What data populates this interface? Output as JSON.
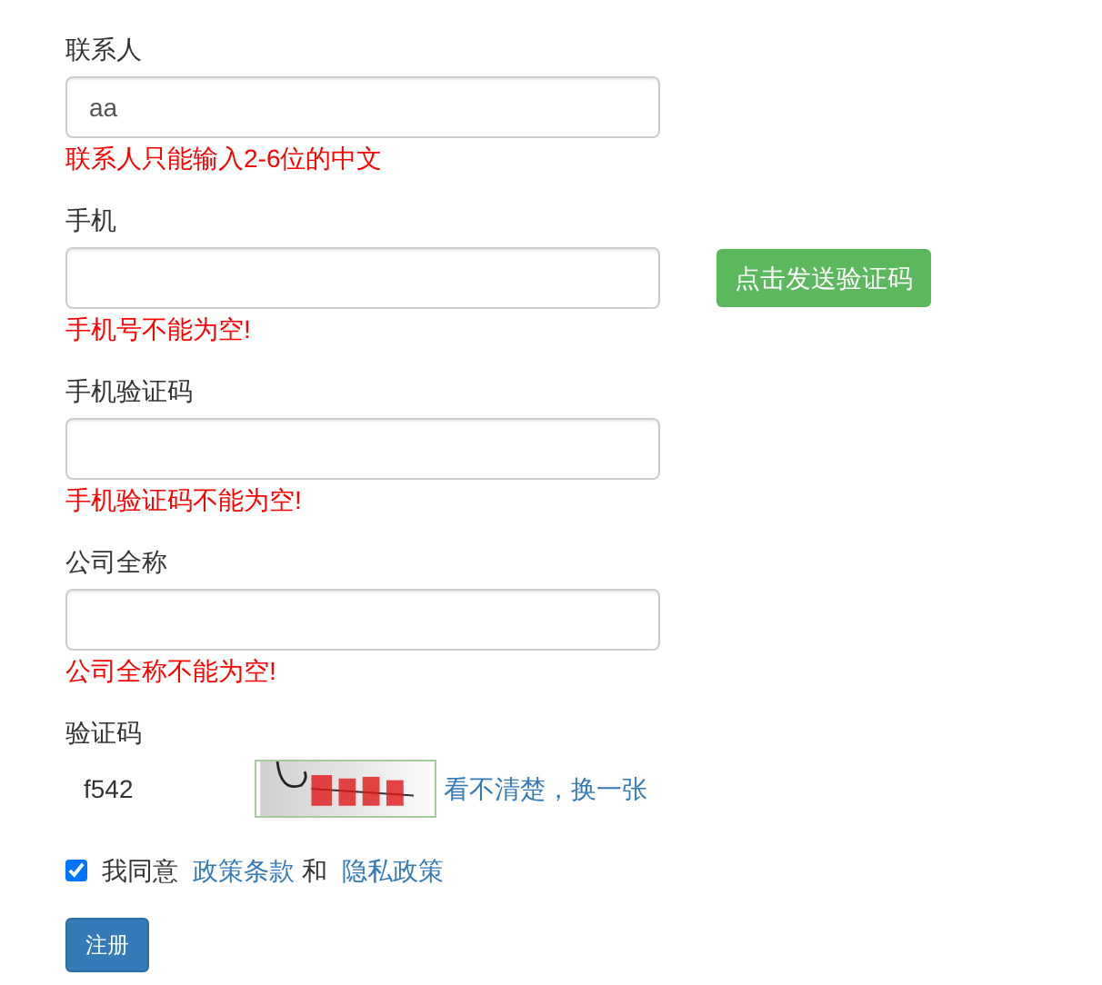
{
  "fields": [
    {
      "label": "联系人",
      "value": "aa",
      "error": "联系人只能输入2-6位的中文"
    },
    {
      "label": "手机",
      "error": "手机号不能为空!",
      "button": "点击发送验证码"
    },
    {
      "label": "手机验证码",
      "error": "手机验证码不能为空!"
    },
    {
      "label": "公司全称",
      "error": "公司全称不能为空!"
    }
  ],
  "captcha": {
    "label": "验证码",
    "value": "f542",
    "refresh_link": "看不清楚，换一张"
  },
  "agreement": {
    "checked": true,
    "text": "我同意",
    "link1": "政策条款",
    "joiner": "和",
    "link2": "隐私政策"
  },
  "submit": "注册"
}
